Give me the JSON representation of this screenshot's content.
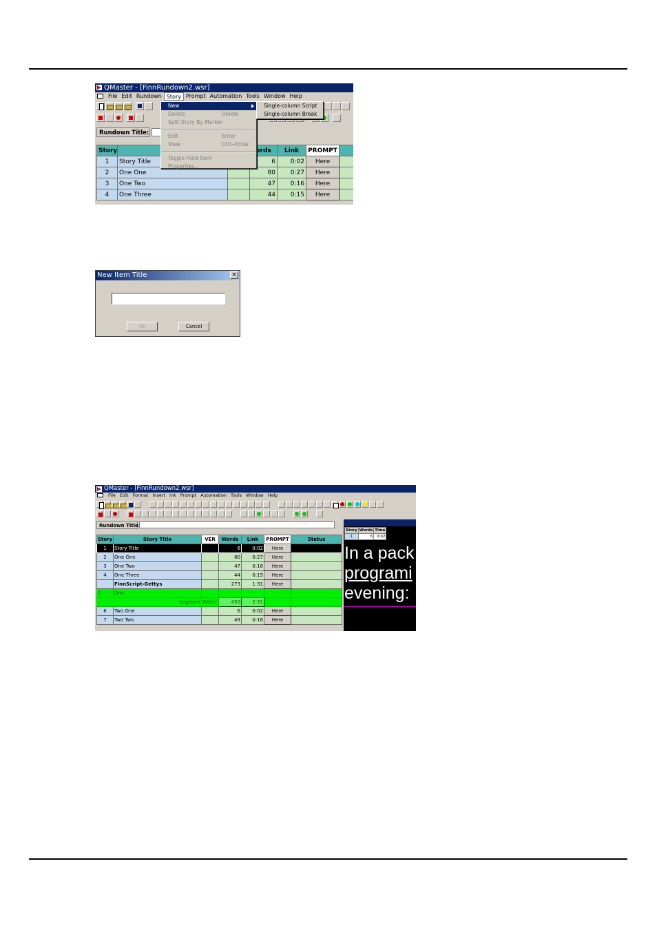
{
  "shot1": {
    "window_title": "QMaster - [FinnRundown2.wsr]",
    "menu": [
      "File",
      "Edit",
      "Rundown",
      "Story",
      "Prompt",
      "Automation",
      "Tools",
      "Window",
      "Help"
    ],
    "rundown_title_label": "Rundown Title:",
    "story_menu": {
      "items": [
        {
          "label": "New",
          "shortcut": ""
        },
        {
          "label": "Delete",
          "shortcut": "Delete"
        },
        {
          "label": "Split Story By Marker",
          "shortcut": ""
        },
        {
          "label": "Edit",
          "shortcut": "Enter"
        },
        {
          "label": "View",
          "shortcut": "Ctrl+Enter"
        },
        {
          "label": "Toggle Hold Item",
          "shortcut": ""
        },
        {
          "label": "Properties...",
          "shortcut": ""
        }
      ],
      "submenu": [
        "Single-column Script",
        "Single-column Break"
      ]
    },
    "columns": [
      "Story",
      "S",
      "",
      "ords",
      "Link",
      "PROMPT",
      ""
    ],
    "rows": [
      {
        "num": "1",
        "title": "Story Title",
        "words": "6",
        "link": "0:02",
        "prompt": "Here"
      },
      {
        "num": "2",
        "title": "One One",
        "words": "80",
        "link": "0:27",
        "prompt": "Here"
      },
      {
        "num": "3",
        "title": "One Two",
        "words": "47",
        "link": "0:16",
        "prompt": "Here"
      },
      {
        "num": "4",
        "title": "One Three",
        "words": "44",
        "link": "0:15",
        "prompt": "Here"
      }
    ]
  },
  "dialog": {
    "title": "New Item Title",
    "close": "×",
    "input_value": "",
    "ok_label": "Ok",
    "cancel_label": "Cancel"
  },
  "shot2": {
    "window_title": "QMaster - [FinnRundown2.wsr]",
    "menu": [
      "File",
      "Edit",
      "Format",
      "Insert",
      "Ink",
      "Prompt",
      "Automation",
      "Tools",
      "Window",
      "Help"
    ],
    "rundown_title_label": "Rundown Title:",
    "columns": [
      "Story",
      "Story Title",
      "VER",
      "Words",
      "Link",
      "PROMPT",
      "Status"
    ],
    "rows": [
      {
        "num": "1",
        "title": "Story Title",
        "words": "6",
        "link": "0:02",
        "prompt": "Here"
      },
      {
        "num": "2",
        "title": "One One",
        "words": "80",
        "link": "0:27",
        "prompt": "Here"
      },
      {
        "num": "3",
        "title": "One Two",
        "words": "47",
        "link": "0:16",
        "prompt": "Here"
      },
      {
        "num": "4",
        "title": "One Three",
        "words": "44",
        "link": "0:15",
        "prompt": "Here"
      },
      {
        "num": "",
        "title": "FinnScript-Gettys",
        "words": "273",
        "link": "1:31",
        "prompt": "Here"
      }
    ],
    "segment": {
      "num": "5",
      "title": "One",
      "totals_label": "Segment Totals:",
      "words": "450",
      "link": "2:31"
    },
    "rows_after": [
      {
        "num": "6",
        "title": "Two One",
        "words": "6",
        "link": "0:02",
        "prompt": "Here"
      },
      {
        "num": "7",
        "title": "Two Two",
        "words": "49",
        "link": "0:16",
        "prompt": "Here"
      }
    ],
    "preview": {
      "mini_headers": [
        "Story",
        "Words",
        "Time"
      ],
      "mini_values": [
        "1",
        "6",
        "0:02"
      ],
      "lines": [
        "In a pack",
        "programi",
        "evening:"
      ]
    }
  }
}
